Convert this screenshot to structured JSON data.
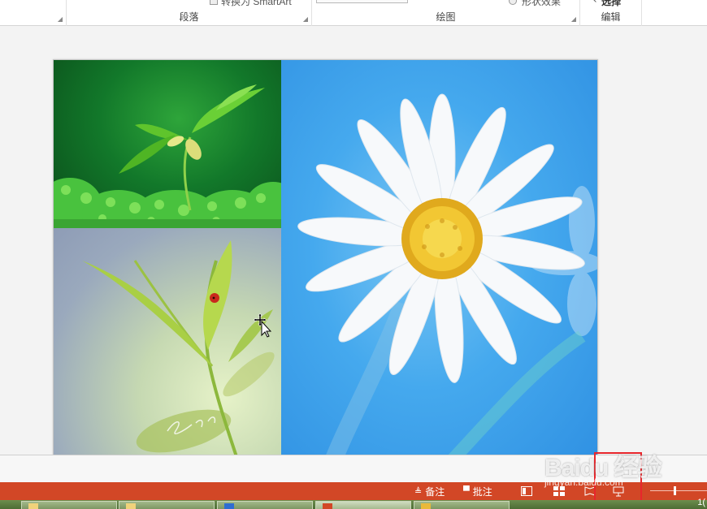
{
  "ribbon": {
    "cut_left_text": "",
    "convert_smartart": "转换为 SmartArt",
    "shape_effects": "形状效果",
    "select_label": "选择",
    "groups": [
      {
        "label": "段落"
      },
      {
        "label": "绘图"
      },
      {
        "label": "编辑"
      }
    ]
  },
  "statusbar": {
    "notes_label": "备注",
    "comments_label": "批注",
    "zoom_percent_fragment": "1("
  },
  "watermark": {
    "brand": "Baidu 经验",
    "url": "jingyan.baidu.com"
  },
  "colors": {
    "status_bar": "#d24726",
    "highlight": "#e8262c"
  }
}
